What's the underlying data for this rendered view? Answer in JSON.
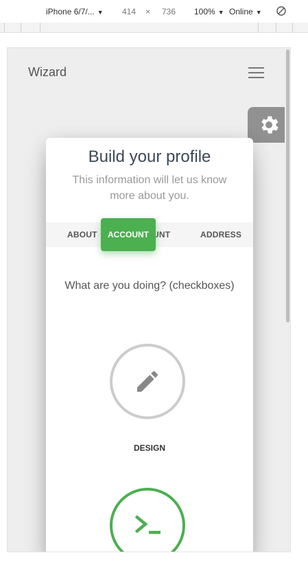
{
  "devtools": {
    "device": "iPhone 6/7/...",
    "width": "414",
    "times": "×",
    "height": "736",
    "zoom": "100%",
    "network": "Online",
    "caret": "▼"
  },
  "app": {
    "title": "Wizard",
    "menu_icon": "hamburger-menu-icon",
    "settings_icon": "gear-icon"
  },
  "wizard": {
    "title": "Build your profile",
    "subtitle": "This information will let us know more about you.",
    "tabs": [
      "ABOUT",
      "UNT",
      "ADDRESS"
    ],
    "active_tab": "ACCOUNT",
    "question": "What are you doing? (checkboxes)",
    "choices": [
      {
        "label": "DESIGN",
        "icon": "pencil-icon",
        "selected": false
      },
      {
        "label": "",
        "icon": "terminal-icon",
        "selected": true
      }
    ]
  },
  "colors": {
    "accent": "#4caf50",
    "page_bg": "#eeeeee",
    "card_bg": "#ffffff"
  }
}
